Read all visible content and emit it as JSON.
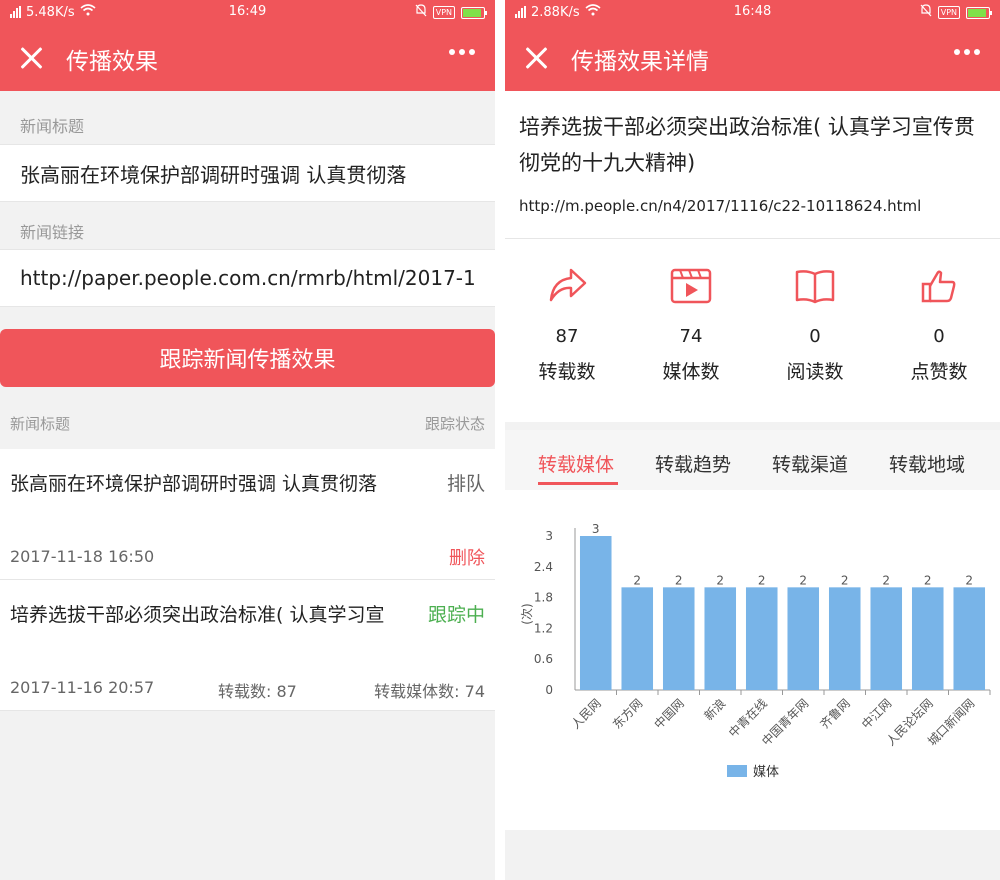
{
  "left": {
    "status": {
      "speed": "5.48K/s",
      "time": "16:49",
      "vpn": "VPN"
    },
    "nav_title": "传播效果",
    "form": {
      "title_label": "新闻标题",
      "title_value": "张高丽在环境保护部调研时强调 认真贯彻落",
      "link_label": "新闻链接",
      "link_value": "http://paper.people.com.cn/rmrb/html/2017-1",
      "button_label": "跟踪新闻传播效果"
    },
    "list_header": {
      "title": "新闻标题",
      "status": "跟踪状态"
    },
    "items": [
      {
        "title": "张高丽在环境保护部调研时强调  认真贯彻落",
        "status": "排队",
        "date": "2017-11-18  16:50",
        "delete": "删除"
      },
      {
        "title": "培养选拔干部必须突出政治标准(  认真学习宣",
        "status": "跟踪中",
        "date": "2017-11-16  20:57",
        "reprint": "转载数:  87",
        "media": "转载媒体数:  74"
      }
    ]
  },
  "right": {
    "status": {
      "speed": "2.88K/s",
      "time": "16:48",
      "vpn": "VPN"
    },
    "nav_title": "传播效果详情",
    "title": "培养选拔干部必须突出政治标准(  认真学习宣传贯彻党的十九大精神)",
    "url": "http://m.people.cn/n4/2017/1116/c22-10118624.html",
    "stats": [
      {
        "icon": "share-arrow-icon",
        "value": "87",
        "label": "转载数"
      },
      {
        "icon": "video-icon",
        "value": "74",
        "label": "媒体数"
      },
      {
        "icon": "book-icon",
        "value": "0",
        "label": "阅读数"
      },
      {
        "icon": "thumbs-up-icon",
        "value": "0",
        "label": "点赞数"
      }
    ],
    "tabs": [
      "转载媒体",
      "转载趋势",
      "转载渠道",
      "转载地域"
    ],
    "active_tab": 0
  },
  "colors": {
    "accent": "#f0555a",
    "green": "#4caf50",
    "bar": "#78b4e8"
  },
  "chart_data": {
    "type": "bar",
    "categories": [
      "人民网",
      "东方网",
      "中国网",
      "新浪",
      "中青在线",
      "中国青年网",
      "齐鲁网",
      "中江网",
      "人民论坛网",
      "城口新闻网"
    ],
    "series": [
      {
        "name": "媒体",
        "values": [
          3,
          2,
          2,
          2,
          2,
          2,
          2,
          2,
          2,
          2
        ]
      }
    ],
    "ylabel": "(次)",
    "yticks": [
      "0",
      "0.6",
      "1.2",
      "1.8",
      "2.4",
      "3"
    ],
    "ylim": [
      0,
      3
    ],
    "legend": "bottom",
    "grid": false
  }
}
